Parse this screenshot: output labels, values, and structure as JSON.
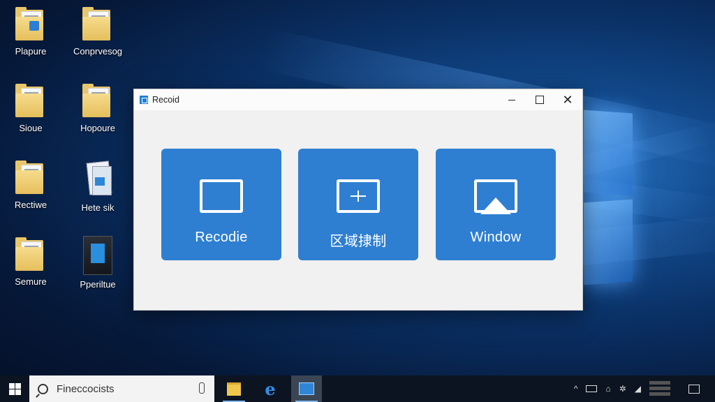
{
  "desktop": {
    "icons": [
      {
        "label": "Plapure",
        "icon": "folder-icon"
      },
      {
        "label": "Conprvesog",
        "icon": "folder-icon"
      },
      {
        "label": "Sioue",
        "icon": "folder-icon"
      },
      {
        "label": "Hopoure",
        "icon": "folder-icon"
      },
      {
        "label": "Rectiwe",
        "icon": "folder-icon"
      },
      {
        "label": "Hete sik",
        "icon": "document-icon"
      },
      {
        "label": "Semure",
        "icon": "folder-icon"
      },
      {
        "label": "Pperiltue",
        "icon": "file-icon"
      }
    ]
  },
  "app": {
    "title": "Recoid",
    "minimize_glyph": "—",
    "close_glyph": "✕",
    "accent": "#2e7fd1",
    "tiles": [
      {
        "label": "Recodie",
        "icon": "fullscreen-icon"
      },
      {
        "label": "区域捸制",
        "icon": "region-icon"
      },
      {
        "label": "Window",
        "icon": "window-icon"
      }
    ]
  },
  "taskbar": {
    "search_text": "Fineccocists",
    "apps": [
      "file-explorer-icon",
      "edge-icon",
      "recorder-icon"
    ],
    "edge_glyph": "e"
  }
}
